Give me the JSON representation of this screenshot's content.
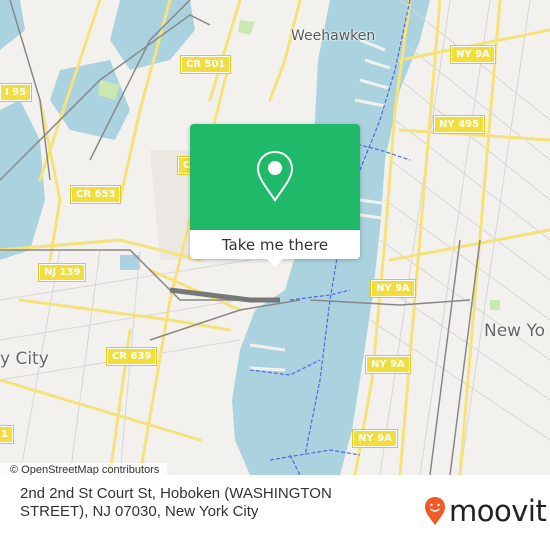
{
  "map": {
    "places": [
      {
        "id": "weehawken",
        "label": "Weehawken"
      },
      {
        "id": "new-york",
        "label": "New Yo"
      },
      {
        "id": "jersey-city",
        "label": "y City"
      }
    ],
    "shields": [
      {
        "id": "cr501",
        "label": "CR 501"
      },
      {
        "id": "i95",
        "label": "I 95"
      },
      {
        "id": "cr653",
        "label": "CR 653"
      },
      {
        "id": "cr-partial",
        "label": "C"
      },
      {
        "id": "nj139",
        "label": "NJ 139"
      },
      {
        "id": "cr639",
        "label": "CR 639"
      },
      {
        "id": "ny9a-1",
        "label": "NY 9A"
      },
      {
        "id": "ny495",
        "label": "NY 495"
      },
      {
        "id": "ny9a-2",
        "label": "NY 9A"
      },
      {
        "id": "ny9a-3",
        "label": "NY 9A"
      },
      {
        "id": "ny9a-4",
        "label": "NY 9A"
      },
      {
        "id": "edge-partial",
        "label": "1"
      }
    ],
    "attribution": "© OpenStreetMap contributors",
    "colors": {
      "water": "#aad3df",
      "land": "#f2f1ed",
      "road": "#f6e27a",
      "popup": "#1eb969"
    }
  },
  "popup": {
    "icon": "map-pin-icon",
    "button_label": "Take me there"
  },
  "footer": {
    "address_line1": "2nd 2nd St Court St, Hoboken (WASHINGTON",
    "address_line2": "STREET), NJ 07030, New York City",
    "brand": "moovit",
    "brand_color": "#f15a29"
  }
}
